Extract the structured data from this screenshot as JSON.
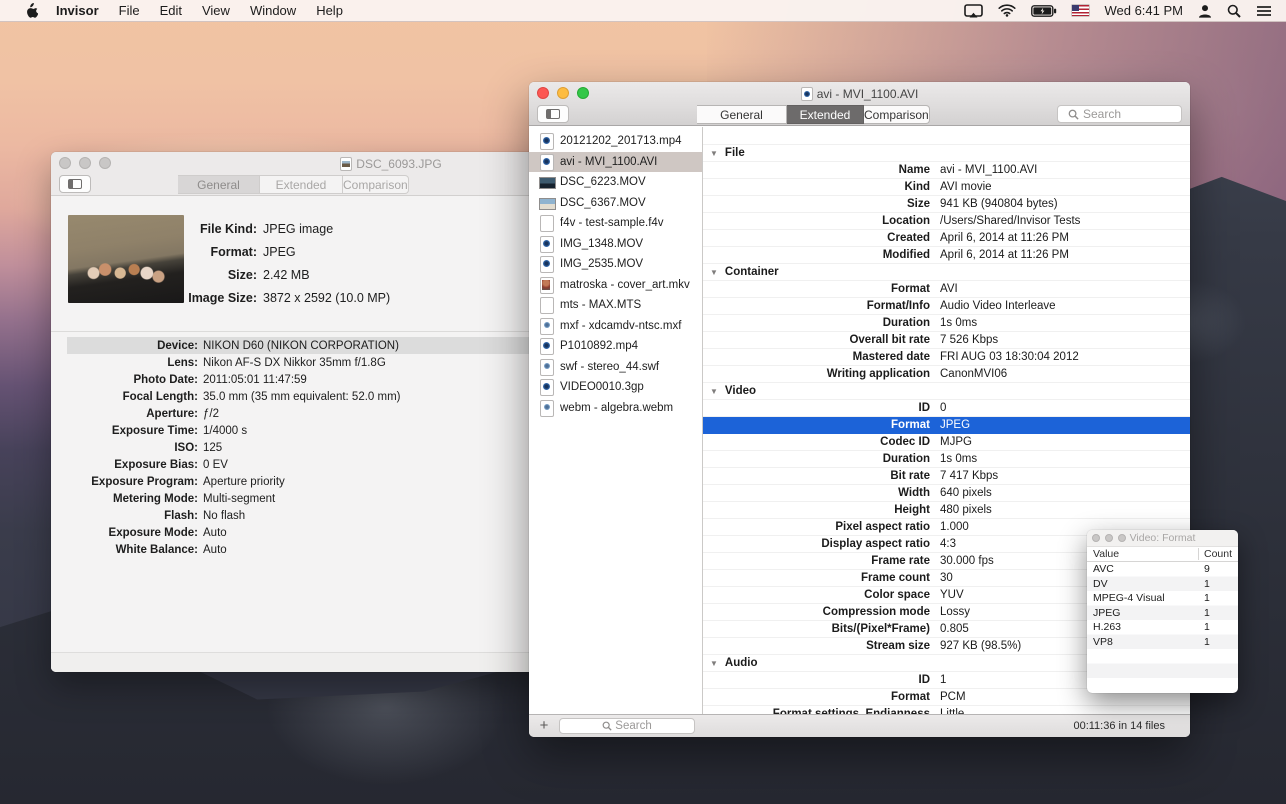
{
  "colors": {
    "selection_blue": "#1c63d8",
    "sidebar_selection": "#cfc7c3",
    "menubar_bg": "#faf3ef"
  },
  "menu_bar": {
    "items": [
      {
        "label": "Invisor",
        "bold": true
      },
      {
        "label": "File"
      },
      {
        "label": "Edit"
      },
      {
        "label": "View"
      },
      {
        "label": "Window"
      },
      {
        "label": "Help"
      }
    ],
    "clock": "Wed 6:41 PM"
  },
  "fg_window": {
    "title": "avi - MVI_1100.AVI",
    "tabs": [
      {
        "label": "General"
      },
      {
        "label": "Extended",
        "active": true
      },
      {
        "label": "Comparison"
      }
    ],
    "toolbar_search_placeholder": "Search",
    "sidebar": {
      "add_label": "+",
      "search_placeholder": "Search",
      "files": [
        {
          "name": "20121202_201713.mp4",
          "icon": "ic-movie"
        },
        {
          "name": "avi - MVI_1100.AVI",
          "icon": "ic-movie",
          "selected": true
        },
        {
          "name": "DSC_6223.MOV",
          "icon": "ic-photo-dark"
        },
        {
          "name": "DSC_6367.MOV",
          "icon": "ic-photo-light"
        },
        {
          "name": "f4v - test-sample.f4v",
          "icon": "ic-blank"
        },
        {
          "name": "IMG_1348.MOV",
          "icon": "ic-movie"
        },
        {
          "name": "IMG_2535.MOV",
          "icon": "ic-movie"
        },
        {
          "name": "matroska - cover_art.mkv",
          "icon": "ic-person"
        },
        {
          "name": "mts - MAX.MTS",
          "icon": "ic-blank"
        },
        {
          "name": "mxf - xdcamdv-ntsc.mxf",
          "icon": "ic-media"
        },
        {
          "name": "P1010892.mp4",
          "icon": "ic-movie"
        },
        {
          "name": "swf - stereo_44.swf",
          "icon": "ic-media"
        },
        {
          "name": "VIDEO0010.3gp",
          "icon": "ic-movie"
        },
        {
          "name": "webm - algebra.webm",
          "icon": "ic-media"
        }
      ]
    },
    "details": [
      {
        "type": "hdr",
        "label": "File"
      },
      {
        "type": "row",
        "label": "Name",
        "value": "avi - MVI_1100.AVI"
      },
      {
        "type": "row",
        "label": "Kind",
        "value": "AVI movie"
      },
      {
        "type": "row",
        "label": "Size",
        "value": "941 KB (940804 bytes)"
      },
      {
        "type": "row",
        "label": "Location",
        "value": "/Users/Shared/Invisor Tests"
      },
      {
        "type": "row",
        "label": "Created",
        "value": "April 6, 2014 at 11:26 PM"
      },
      {
        "type": "row",
        "label": "Modified",
        "value": "April 6, 2014 at 11:26 PM"
      },
      {
        "type": "hdr",
        "label": "Container"
      },
      {
        "type": "row",
        "label": "Format",
        "value": "AVI"
      },
      {
        "type": "row",
        "label": "Format/Info",
        "value": "Audio Video Interleave"
      },
      {
        "type": "row",
        "label": "Duration",
        "value": "1s 0ms"
      },
      {
        "type": "row",
        "label": "Overall bit rate",
        "value": "7 526 Kbps"
      },
      {
        "type": "row",
        "label": "Mastered date",
        "value": "FRI AUG 03 18:30:04 2012"
      },
      {
        "type": "row",
        "label": "Writing application",
        "value": "CanonMVI06"
      },
      {
        "type": "hdr",
        "label": "Video"
      },
      {
        "type": "row",
        "label": "ID",
        "value": "0"
      },
      {
        "type": "row",
        "label": "Format",
        "value": "JPEG",
        "selected": true
      },
      {
        "type": "row",
        "label": "Codec ID",
        "value": "MJPG"
      },
      {
        "type": "row",
        "label": "Duration",
        "value": "1s 0ms"
      },
      {
        "type": "row",
        "label": "Bit rate",
        "value": "7 417 Kbps"
      },
      {
        "type": "row",
        "label": "Width",
        "value": "640 pixels"
      },
      {
        "type": "row",
        "label": "Height",
        "value": "480 pixels"
      },
      {
        "type": "row",
        "label": "Pixel aspect ratio",
        "value": "1.000"
      },
      {
        "type": "row",
        "label": "Display aspect ratio",
        "value": "4:3"
      },
      {
        "type": "row",
        "label": "Frame rate",
        "value": "30.000 fps"
      },
      {
        "type": "row",
        "label": "Frame count",
        "value": "30"
      },
      {
        "type": "row",
        "label": "Color space",
        "value": "YUV"
      },
      {
        "type": "row",
        "label": "Compression mode",
        "value": "Lossy"
      },
      {
        "type": "row",
        "label": "Bits/(Pixel*Frame)",
        "value": "0.805"
      },
      {
        "type": "row",
        "label": "Stream size",
        "value": "927 KB (98.5%)"
      },
      {
        "type": "hdr",
        "label": "Audio"
      },
      {
        "type": "row",
        "label": "ID",
        "value": "1"
      },
      {
        "type": "row",
        "label": "Format",
        "value": "PCM"
      },
      {
        "type": "row",
        "label": "Format settings, Endianness",
        "value": "Little"
      }
    ],
    "status": "00:11:36 in 14 files"
  },
  "bg_window": {
    "title": "DSC_6093.JPG",
    "tabs": [
      {
        "label": "General",
        "active": true
      },
      {
        "label": "Extended"
      },
      {
        "label": "Comparison"
      }
    ],
    "info_rows": [
      {
        "label": "File Kind:",
        "value": "JPEG image"
      },
      {
        "label": "Format:",
        "value": "JPEG"
      },
      {
        "label": "Size:",
        "value": "2.42 MB"
      },
      {
        "label": "Image Size:",
        "value": "3872 x 2592 (10.0 MP)"
      }
    ],
    "meta_rows": [
      {
        "label": "Device:",
        "value": "NIKON D60 (NIKON CORPORATION)",
        "highlight": true
      },
      {
        "label": "Lens:",
        "value": "Nikon AF-S DX Nikkor 35mm f/1.8G"
      },
      {
        "label": "Photo Date:",
        "value": "2011:05:01 11:47:59"
      },
      {
        "label": "Focal Length:",
        "value": "35.0 mm (35 mm equivalent: 52.0 mm)"
      },
      {
        "label": "Aperture:",
        "value": "ƒ/2"
      },
      {
        "label": "Exposure Time:",
        "value": "1/4000 s"
      },
      {
        "label": "ISO:",
        "value": "125"
      },
      {
        "label": "Exposure Bias:",
        "value": "0 EV"
      },
      {
        "label": "Exposure Program:",
        "value": "Aperture priority"
      },
      {
        "label": "Metering Mode:",
        "value": "Multi-segment"
      },
      {
        "label": "Flash:",
        "value": "No flash"
      },
      {
        "label": "Exposure Mode:",
        "value": "Auto"
      },
      {
        "label": "White Balance:",
        "value": "Auto"
      }
    ]
  },
  "popup": {
    "title": "Video: Format",
    "columns": {
      "value": "Value",
      "count": "Count"
    },
    "rows": [
      {
        "value": "AVC",
        "count": "9"
      },
      {
        "value": "DV",
        "count": "1"
      },
      {
        "value": "MPEG-4 Visual",
        "count": "1"
      },
      {
        "value": "JPEG",
        "count": "1"
      },
      {
        "value": "H.263",
        "count": "1"
      },
      {
        "value": "VP8",
        "count": "1"
      }
    ]
  }
}
